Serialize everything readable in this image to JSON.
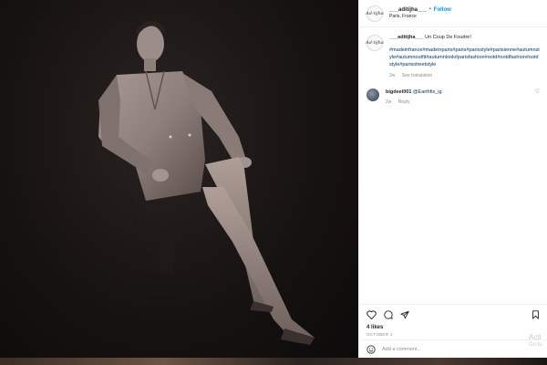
{
  "post": {
    "username": "___aditijha___",
    "follow_label": "Follow",
    "location": "Paris, France",
    "logo_text": "Ad·tijha",
    "caption_user": "___aditijha___",
    "caption_text": "Un Coup De Foudre!",
    "hashtags": "#madeinfrance#madeinparis#paris#parisstyle#parisienne#autumnstyle#autumnoutfit#autumnlook#parisfashion#ootd#ootdfashion#ootdstyle#parisstreetstyle",
    "caption_age": "2w",
    "see_translation": "See translation"
  },
  "comment": {
    "username": "bigdeel001",
    "mention": "@Earthfix_ig",
    "age": "2w",
    "reply_label": "Reply"
  },
  "actions": {
    "like_icon": "heart-icon",
    "comment_icon": "comment-icon",
    "share_icon": "share-icon",
    "save_icon": "bookmark-icon",
    "likes": "4 likes",
    "date": "October 1"
  },
  "add_comment": {
    "placeholder": "Add a comment...",
    "emoji_icon": "emoji-icon"
  },
  "watermark": {
    "line1": "Acti",
    "line2": "Go to"
  }
}
